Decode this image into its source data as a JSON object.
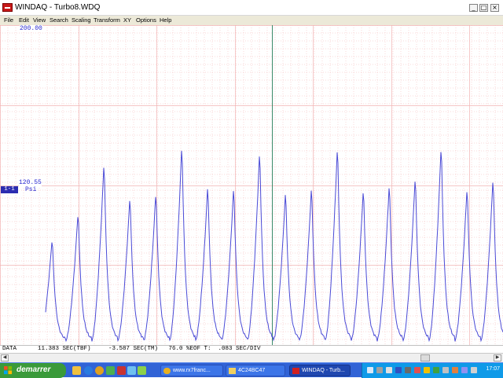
{
  "window": {
    "title": "WINDAQ - Turbo8.WDQ",
    "controls": {
      "minimize": "_",
      "maximize": "□",
      "close": "×"
    }
  },
  "menu": [
    "File",
    "Edit",
    "View",
    "Search",
    "Scaling",
    "Transform",
    "XY",
    "Options",
    "Help"
  ],
  "plot": {
    "y_top_label": "200.00",
    "y_mid_label": "120.55",
    "channel_badge": "1-1",
    "unit": "Psi",
    "grid_color": "#f2b3b3",
    "trace_color": "#4a4ad6",
    "cursor_color": "#3c8a6a"
  },
  "chart_data": {
    "type": "line",
    "title": "",
    "xlabel": "",
    "ylabel": "Psi",
    "ylim": [
      0,
      200
    ],
    "y_ticks_labeled": [
      200.0,
      120.55
    ],
    "grid": true,
    "cursor_time_fraction": 0.54,
    "series": [
      {
        "name": "",
        "pulse_peaks_psi": [
          68,
          85,
          117,
          95,
          98,
          128,
          102,
          101,
          124,
          98,
          101,
          127,
          100,
          103,
          108,
          128,
          101,
          107,
          98
        ]
      }
    ]
  },
  "status": {
    "text": "DATA      11.383 SEC(TBF)     -3.587 SEC(TM)   76.0 %EOF T:  .083 SEC/DIV"
  },
  "taskbar": {
    "start_label": "demarrer",
    "tasks": [
      {
        "label": "www.rx7franc...",
        "icon": "chrome-icon",
        "active": false
      },
      {
        "label": "4C24BC47",
        "icon": "folder-icon",
        "active": false
      },
      {
        "label": "WINDAQ - Turb...",
        "icon": "windaq-icon",
        "active": true
      }
    ],
    "clock": "17:07"
  }
}
